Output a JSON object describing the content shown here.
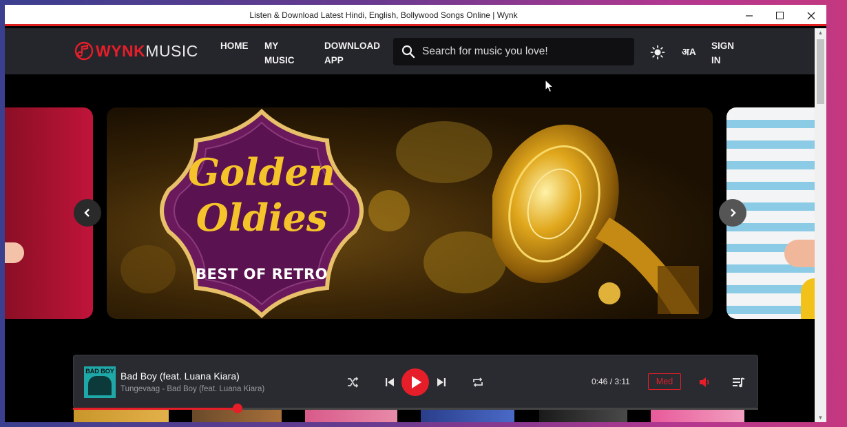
{
  "window": {
    "title": "Listen & Download Latest Hindi, English, Bollywood Songs Online | Wynk"
  },
  "header": {
    "logo_brand": "WYNK",
    "logo_suffix": "MUSIC",
    "nav": {
      "home": "HOME",
      "my_music": "MY MUSIC",
      "download_app": "DOWNLOAD APP"
    },
    "search_placeholder": "Search for music you love!",
    "lang_label": "अA",
    "sign_in": "SIGN IN"
  },
  "banner": {
    "line1": "Golden",
    "line2": "Oldies",
    "line3": "BEST OF RETRO"
  },
  "player": {
    "album_art_text": "BAD BOY",
    "song_title": "Bad Boy (feat. Luana Kiara)",
    "song_subtitle": "Tungevaag - Bad Boy (feat. Luana Kiara)",
    "time": "0:46 / 3:11",
    "quality": "Med",
    "progress_fraction": 0.24
  },
  "colors": {
    "accent": "#e61e2a",
    "header_bg": "#25262b",
    "player_bg": "#2a2b30"
  }
}
